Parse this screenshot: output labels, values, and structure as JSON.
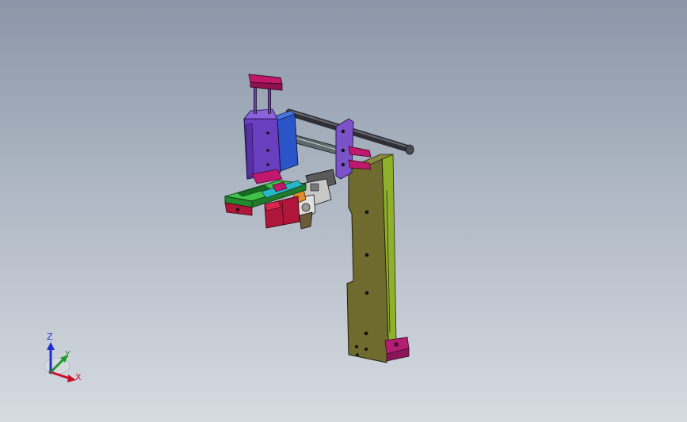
{
  "viewport": {
    "background_top": "#8a97a8",
    "background_bottom": "#d6dbe1"
  },
  "triad": {
    "z_label": "Z",
    "y_label": "Y",
    "x_label": "X",
    "z_color": "#1f2fd0",
    "y_color": "#1c9a2a",
    "x_color": "#c8102e"
  },
  "model": {
    "frame_color": "#6f6a2e",
    "frame_side_color": "#8fb02a",
    "carriage_color": "#6a3fbf",
    "top_bracket_color": "#c0186c",
    "guide_rod_color": "#2e2e34",
    "blue_block_color": "#2a55c9",
    "base_plate_color": "#2fae3c",
    "red_block_color": "#b01639",
    "bracket_color": "#7b52c8"
  }
}
